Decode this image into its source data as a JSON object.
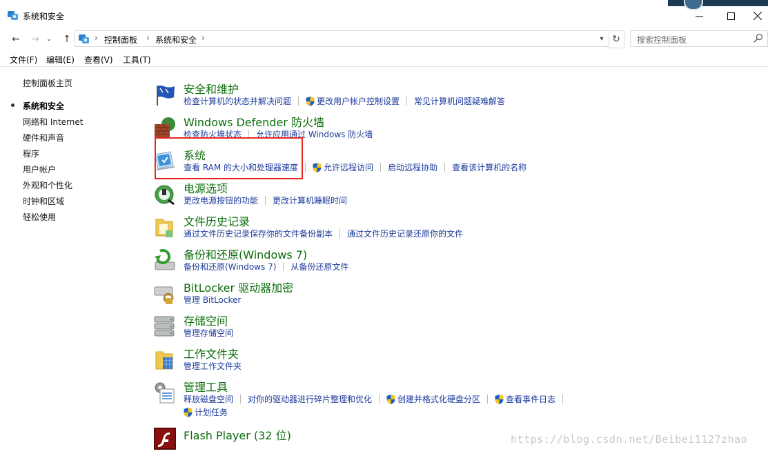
{
  "window": {
    "title": "系统和安全",
    "minimize_icon": "minimize-icon",
    "maximize_icon": "maximize-icon",
    "close_icon": "close-icon"
  },
  "nav": {
    "breadcrumbs": [
      "控制面板",
      "系统和安全"
    ],
    "search_placeholder": "搜索控制面板"
  },
  "menu": [
    {
      "label": "文件(F)"
    },
    {
      "label": "编辑(E)"
    },
    {
      "label": "查看(V)"
    },
    {
      "label": "工具(T)"
    }
  ],
  "sidebar": {
    "items": [
      {
        "label": "控制面板主页"
      },
      {
        "label": "系统和安全",
        "active": true
      },
      {
        "label": "网络和 Internet"
      },
      {
        "label": "硬件和声音"
      },
      {
        "label": "程序"
      },
      {
        "label": "用户帐户"
      },
      {
        "label": "外观和个性化"
      },
      {
        "label": "时钟和区域"
      },
      {
        "label": "轻松使用"
      }
    ]
  },
  "categories": [
    {
      "title": "安全和维护",
      "icon": "security-flag-icon",
      "links": [
        {
          "label": "检查计算机的状态并解决问题"
        },
        {
          "label": "更改用户帐户控制设置",
          "shield": true
        },
        {
          "label": "常见计算机问题疑难解答"
        }
      ]
    },
    {
      "title": "Windows Defender 防火墙",
      "icon": "firewall-icon",
      "links": [
        {
          "label": "检查防火墙状态"
        },
        {
          "label": "允许应用通过 Windows 防火墙"
        }
      ]
    },
    {
      "title": "系统",
      "icon": "system-monitor-icon",
      "links": [
        {
          "label": "查看 RAM 的大小和处理器速度"
        },
        {
          "label": "允许远程访问",
          "shield": true
        },
        {
          "label": "启动远程协助"
        },
        {
          "label": "查看该计算机的名称"
        }
      ]
    },
    {
      "title": "电源选项",
      "icon": "power-options-icon",
      "links": [
        {
          "label": "更改电源按钮的功能"
        },
        {
          "label": "更改计算机睡眠时间"
        }
      ]
    },
    {
      "title": "文件历史记录",
      "icon": "file-history-icon",
      "links": [
        {
          "label": "通过文件历史记录保存你的文件备份副本"
        },
        {
          "label": "通过文件历史记录还原你的文件"
        }
      ]
    },
    {
      "title": "备份和还原(Windows 7)",
      "icon": "backup-restore-icon",
      "links": [
        {
          "label": "备份和还原(Windows 7)"
        },
        {
          "label": "从备份还原文件"
        }
      ]
    },
    {
      "title": "BitLocker 驱动器加密",
      "icon": "bitlocker-icon",
      "links": [
        {
          "label": "管理 BitLocker"
        }
      ]
    },
    {
      "title": "存储空间",
      "icon": "storage-spaces-icon",
      "links": [
        {
          "label": "管理存储空间"
        }
      ]
    },
    {
      "title": "工作文件夹",
      "icon": "work-folders-icon",
      "links": [
        {
          "label": "管理工作文件夹"
        }
      ]
    },
    {
      "title": "管理工具",
      "icon": "admin-tools-icon",
      "links": [
        {
          "label": "释放磁盘空间"
        },
        {
          "label": "对你的驱动器进行碎片整理和优化"
        },
        {
          "label": "创建并格式化硬盘分区",
          "shield": true
        },
        {
          "label": "查看事件日志",
          "shield": true
        }
      ],
      "links2": [
        {
          "label": "计划任务",
          "shield": true
        }
      ]
    },
    {
      "title": "Flash Player (32 位)",
      "icon": "flash-player-icon",
      "links": []
    }
  ],
  "watermark": "https://blog.csdn.net/Beibei1127zhao",
  "colors": {
    "title_green": "#0b6e0b",
    "link_blue": "#1c3a9c",
    "highlight_red": "#e8251e"
  }
}
